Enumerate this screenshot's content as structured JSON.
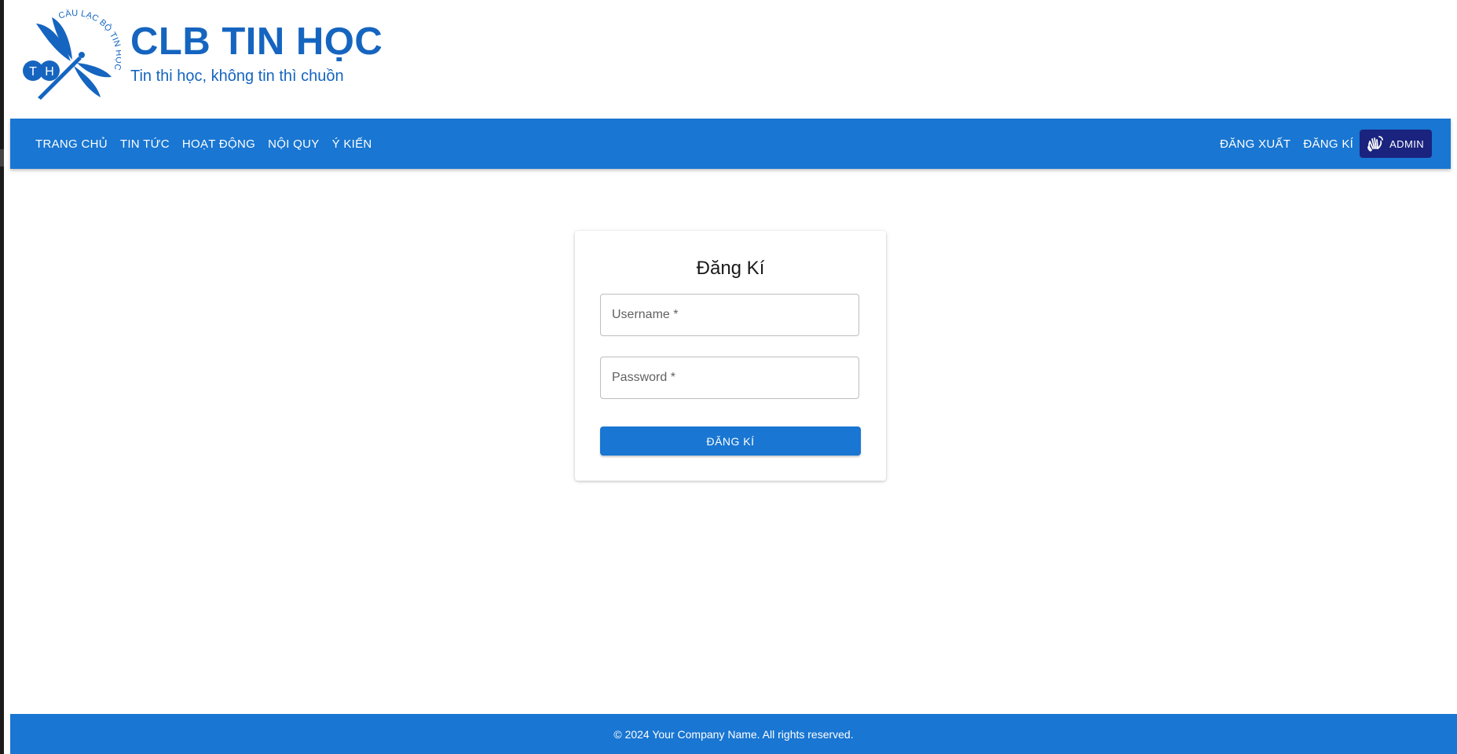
{
  "brand": {
    "logo_icon": "dragonfly-logo-icon",
    "logo_ring_text": "CÂU LẠC BỘ TIN HỌC",
    "logo_letters": "T H",
    "title": "CLB TIN HỌC",
    "slogan": "Tin thi học, không tin thì chuồn"
  },
  "navbar": {
    "left_links": [
      {
        "label": "TRANG CHỦ"
      },
      {
        "label": "TIN TỨC"
      },
      {
        "label": "HOẠT ĐỘNG"
      },
      {
        "label": "NỘI QUY"
      },
      {
        "label": "Ý KIẾN"
      }
    ],
    "right_links": [
      {
        "label": "ĐĂNG XUẤT"
      },
      {
        "label": "ĐĂNG KÍ"
      }
    ],
    "admin": {
      "icon": "waving-hand-icon",
      "label": "ADMIN"
    }
  },
  "form": {
    "title": "Đăng Kí",
    "username_placeholder": "Username *",
    "password_placeholder": "Password *",
    "submit_label": "ĐĂNG KÍ"
  },
  "footer": {
    "text": "© 2024 Your Company Name. All rights reserved."
  },
  "colors": {
    "primary": "#1976d2",
    "brand_text": "#1565c0",
    "admin_chip": "#1a237e"
  }
}
